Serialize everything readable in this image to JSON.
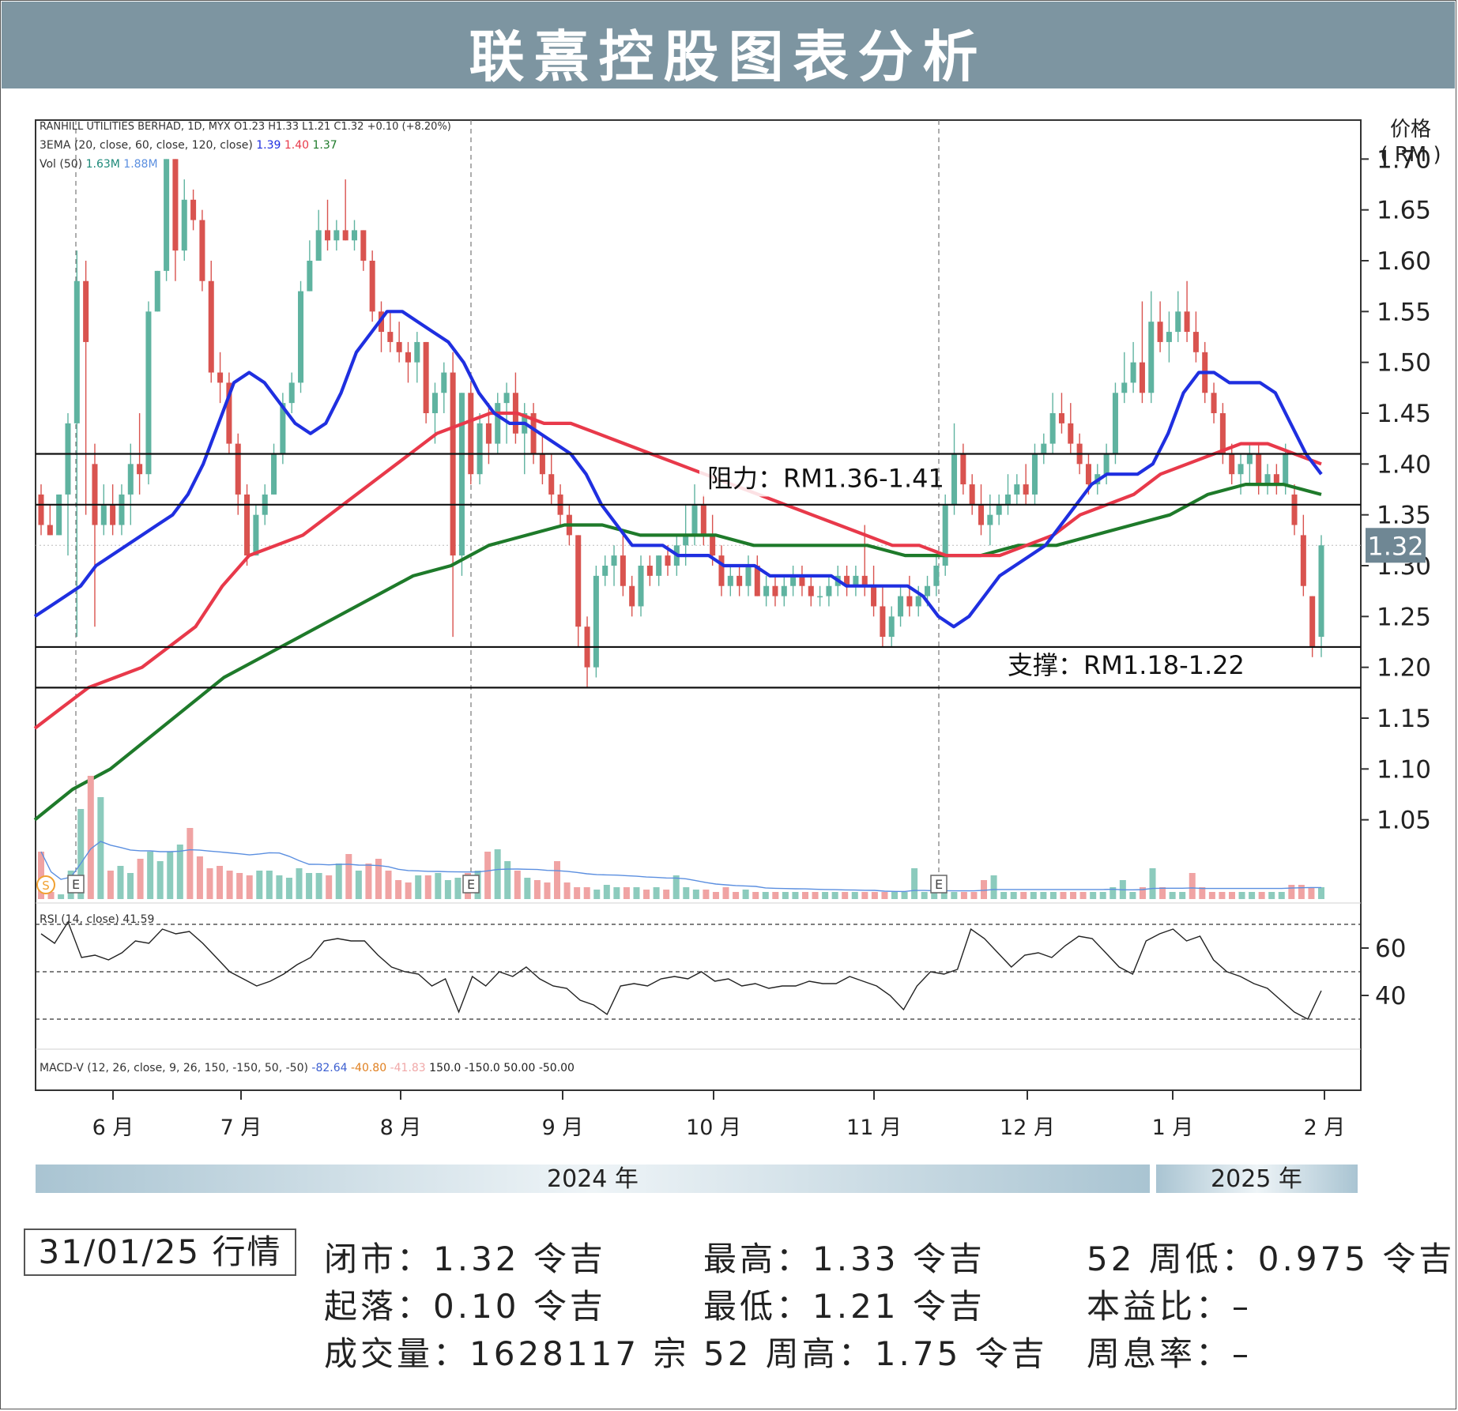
{
  "page_title": "联熹控股图表分析",
  "chart_header": {
    "line1": "RANHILL UTILITIES BERHAD, 1D, MYX  O1.23  H1.33  L1.21  C1.32  +0.10 (+8.20%)",
    "line2_prefix": "3EMA (20, close, 60, close, 120, close)",
    "ema_values": [
      "1.39",
      "1.40",
      "1.37"
    ],
    "vol_prefix": "Vol (50)",
    "vol_values": [
      "1.63M",
      "1.88M"
    ],
    "rsi_prefix": "RSI (14, close)",
    "rsi_value": "41.59",
    "macd_prefix": "MACD-V (12, 26, close, 9, 26, 150, -150, 50, -50)",
    "macd_values": [
      "-82.64",
      "-40.80",
      "-41.83",
      "150.0",
      "-150.0",
      "50.00",
      "-50.00"
    ]
  },
  "axis": {
    "y_title_1": "价格",
    "y_title_2": "( RM )",
    "y_ticks": [
      "1.70",
      "1.65",
      "1.60",
      "1.55",
      "1.50",
      "1.45",
      "1.40",
      "1.35",
      "1.30",
      "1.25",
      "1.20",
      "1.15",
      "1.10",
      "1.05"
    ],
    "rsi_ticks": [
      "60",
      "40"
    ],
    "x_months": [
      "6 月",
      "7 月",
      "8 月",
      "9 月",
      "10 月",
      "11 月",
      "12 月",
      "1 月",
      "2 月"
    ],
    "year_2024": "2024 年",
    "year_2025": "2025 年",
    "last_price": "1.32",
    "earnings_marker": "E",
    "dividend_marker": "S"
  },
  "annotations": {
    "resistance": "阻力：RM1.36-1.41",
    "support": "支撑：RM1.18-1.22"
  },
  "colors": {
    "title_bar": "#7d95a1",
    "up": "#5fb3a0",
    "down": "#d9534f",
    "ema20": "#1f2fe0",
    "ema60": "#e8394a",
    "ema120": "#1e7a2a",
    "vol_up": "#8ccbbd",
    "vol_down": "#f0a3a3",
    "vol_ma": "#5b8fe0",
    "last_price_box": "#6f8794"
  },
  "chart_data": {
    "type": "candlestick",
    "ticker": "RANHILL UTILITIES BERHAD",
    "ylim": [
      1.0,
      1.75
    ],
    "resistance_range": [
      1.36,
      1.41
    ],
    "support_range": [
      1.18,
      1.22
    ],
    "last_close": 1.32,
    "ohlc": [
      [
        1.37,
        1.38,
        1.33,
        1.34
      ],
      [
        1.34,
        1.36,
        1.33,
        1.33
      ],
      [
        1.33,
        1.37,
        1.33,
        1.37
      ],
      [
        1.37,
        1.45,
        1.31,
        1.44
      ],
      [
        1.44,
        1.61,
        1.23,
        1.58
      ],
      [
        1.58,
        1.6,
        1.35,
        1.52
      ],
      [
        1.4,
        1.42,
        1.24,
        1.34
      ],
      [
        1.34,
        1.38,
        1.33,
        1.36
      ],
      [
        1.36,
        1.38,
        1.33,
        1.34
      ],
      [
        1.34,
        1.38,
        1.33,
        1.37
      ],
      [
        1.37,
        1.42,
        1.34,
        1.4
      ],
      [
        1.4,
        1.45,
        1.37,
        1.39
      ],
      [
        1.39,
        1.56,
        1.38,
        1.55
      ],
      [
        1.55,
        1.59,
        1.55,
        1.59
      ],
      [
        1.59,
        1.7,
        1.58,
        1.7
      ],
      [
        1.7,
        1.7,
        1.58,
        1.61
      ],
      [
        1.61,
        1.68,
        1.6,
        1.66
      ],
      [
        1.66,
        1.67,
        1.63,
        1.64
      ],
      [
        1.64,
        1.65,
        1.57,
        1.58
      ],
      [
        1.58,
        1.6,
        1.48,
        1.49
      ],
      [
        1.49,
        1.51,
        1.46,
        1.48
      ],
      [
        1.48,
        1.49,
        1.41,
        1.42
      ],
      [
        1.42,
        1.43,
        1.35,
        1.37
      ],
      [
        1.37,
        1.38,
        1.3,
        1.31
      ],
      [
        1.31,
        1.36,
        1.31,
        1.35
      ],
      [
        1.35,
        1.38,
        1.34,
        1.37
      ],
      [
        1.37,
        1.42,
        1.37,
        1.41
      ],
      [
        1.41,
        1.47,
        1.4,
        1.46
      ],
      [
        1.46,
        1.49,
        1.45,
        1.48
      ],
      [
        1.48,
        1.58,
        1.47,
        1.57
      ],
      [
        1.57,
        1.62,
        1.57,
        1.6
      ],
      [
        1.6,
        1.65,
        1.6,
        1.63
      ],
      [
        1.63,
        1.66,
        1.61,
        1.62
      ],
      [
        1.62,
        1.64,
        1.61,
        1.63
      ],
      [
        1.63,
        1.68,
        1.62,
        1.62
      ],
      [
        1.62,
        1.64,
        1.61,
        1.63
      ],
      [
        1.63,
        1.63,
        1.59,
        1.6
      ],
      [
        1.6,
        1.61,
        1.54,
        1.55
      ],
      [
        1.55,
        1.56,
        1.51,
        1.53
      ],
      [
        1.53,
        1.55,
        1.51,
        1.52
      ],
      [
        1.52,
        1.54,
        1.5,
        1.51
      ],
      [
        1.51,
        1.52,
        1.48,
        1.5
      ],
      [
        1.5,
        1.53,
        1.48,
        1.52
      ],
      [
        1.52,
        1.52,
        1.44,
        1.45
      ],
      [
        1.45,
        1.48,
        1.42,
        1.47
      ],
      [
        1.47,
        1.5,
        1.45,
        1.49
      ],
      [
        1.49,
        1.51,
        1.23,
        1.31
      ],
      [
        1.31,
        1.47,
        1.29,
        1.47
      ],
      [
        1.47,
        1.48,
        1.38,
        1.39
      ],
      [
        1.39,
        1.45,
        1.38,
        1.44
      ],
      [
        1.44,
        1.46,
        1.4,
        1.42
      ],
      [
        1.42,
        1.47,
        1.41,
        1.46
      ],
      [
        1.46,
        1.48,
        1.42,
        1.47
      ],
      [
        1.47,
        1.49,
        1.42,
        1.43
      ],
      [
        1.43,
        1.46,
        1.39,
        1.45
      ],
      [
        1.45,
        1.46,
        1.4,
        1.41
      ],
      [
        1.41,
        1.43,
        1.38,
        1.39
      ],
      [
        1.39,
        1.41,
        1.36,
        1.37
      ],
      [
        1.37,
        1.38,
        1.34,
        1.35
      ],
      [
        1.35,
        1.36,
        1.32,
        1.33
      ],
      [
        1.33,
        1.33,
        1.22,
        1.24
      ],
      [
        1.24,
        1.25,
        1.18,
        1.2
      ],
      [
        1.2,
        1.3,
        1.19,
        1.29
      ],
      [
        1.29,
        1.31,
        1.28,
        1.3
      ],
      [
        1.3,
        1.32,
        1.28,
        1.31
      ],
      [
        1.31,
        1.33,
        1.27,
        1.28
      ],
      [
        1.28,
        1.29,
        1.25,
        1.26
      ],
      [
        1.26,
        1.31,
        1.25,
        1.3
      ],
      [
        1.3,
        1.31,
        1.28,
        1.29
      ],
      [
        1.29,
        1.31,
        1.28,
        1.31
      ],
      [
        1.31,
        1.32,
        1.29,
        1.3
      ],
      [
        1.3,
        1.33,
        1.29,
        1.32
      ],
      [
        1.32,
        1.36,
        1.3,
        1.33
      ],
      [
        1.33,
        1.38,
        1.32,
        1.36
      ],
      [
        1.36,
        1.37,
        1.32,
        1.33
      ],
      [
        1.33,
        1.35,
        1.3,
        1.31
      ],
      [
        1.31,
        1.32,
        1.27,
        1.28
      ],
      [
        1.28,
        1.3,
        1.27,
        1.29
      ],
      [
        1.29,
        1.3,
        1.27,
        1.28
      ],
      [
        1.28,
        1.31,
        1.27,
        1.3
      ],
      [
        1.3,
        1.31,
        1.27,
        1.27
      ],
      [
        1.27,
        1.29,
        1.26,
        1.28
      ],
      [
        1.28,
        1.29,
        1.26,
        1.27
      ],
      [
        1.27,
        1.29,
        1.26,
        1.28
      ],
      [
        1.28,
        1.3,
        1.27,
        1.29
      ],
      [
        1.29,
        1.3,
        1.27,
        1.28
      ],
      [
        1.28,
        1.29,
        1.26,
        1.27
      ],
      [
        1.27,
        1.28,
        1.26,
        1.27
      ],
      [
        1.27,
        1.29,
        1.26,
        1.28
      ],
      [
        1.28,
        1.3,
        1.27,
        1.29
      ],
      [
        1.29,
        1.3,
        1.27,
        1.28
      ],
      [
        1.28,
        1.3,
        1.27,
        1.29
      ],
      [
        1.29,
        1.34,
        1.27,
        1.28
      ],
      [
        1.28,
        1.3,
        1.25,
        1.26
      ],
      [
        1.26,
        1.28,
        1.22,
        1.23
      ],
      [
        1.23,
        1.26,
        1.22,
        1.25
      ],
      [
        1.25,
        1.28,
        1.24,
        1.27
      ],
      [
        1.27,
        1.29,
        1.25,
        1.26
      ],
      [
        1.26,
        1.28,
        1.25,
        1.27
      ],
      [
        1.27,
        1.29,
        1.26,
        1.28
      ],
      [
        1.28,
        1.31,
        1.27,
        1.3
      ],
      [
        1.3,
        1.37,
        1.29,
        1.36
      ],
      [
        1.36,
        1.44,
        1.35,
        1.41
      ],
      [
        1.41,
        1.42,
        1.37,
        1.38
      ],
      [
        1.38,
        1.39,
        1.35,
        1.36
      ],
      [
        1.36,
        1.38,
        1.33,
        1.34
      ],
      [
        1.34,
        1.37,
        1.32,
        1.35
      ],
      [
        1.35,
        1.37,
        1.34,
        1.36
      ],
      [
        1.36,
        1.39,
        1.35,
        1.37
      ],
      [
        1.37,
        1.39,
        1.36,
        1.38
      ],
      [
        1.38,
        1.4,
        1.36,
        1.37
      ],
      [
        1.37,
        1.42,
        1.36,
        1.41
      ],
      [
        1.41,
        1.43,
        1.4,
        1.42
      ],
      [
        1.42,
        1.47,
        1.41,
        1.45
      ],
      [
        1.45,
        1.47,
        1.43,
        1.44
      ],
      [
        1.44,
        1.46,
        1.41,
        1.42
      ],
      [
        1.42,
        1.43,
        1.39,
        1.4
      ],
      [
        1.4,
        1.41,
        1.37,
        1.38
      ],
      [
        1.38,
        1.4,
        1.37,
        1.39
      ],
      [
        1.39,
        1.42,
        1.38,
        1.41
      ],
      [
        1.41,
        1.48,
        1.4,
        1.47
      ],
      [
        1.47,
        1.51,
        1.46,
        1.48
      ],
      [
        1.48,
        1.52,
        1.47,
        1.5
      ],
      [
        1.5,
        1.56,
        1.46,
        1.47
      ],
      [
        1.47,
        1.57,
        1.46,
        1.54
      ],
      [
        1.54,
        1.56,
        1.51,
        1.52
      ],
      [
        1.52,
        1.55,
        1.5,
        1.53
      ],
      [
        1.53,
        1.57,
        1.52,
        1.55
      ],
      [
        1.55,
        1.58,
        1.52,
        1.53
      ],
      [
        1.53,
        1.55,
        1.5,
        1.51
      ],
      [
        1.51,
        1.52,
        1.46,
        1.47
      ],
      [
        1.47,
        1.48,
        1.44,
        1.45
      ],
      [
        1.45,
        1.46,
        1.4,
        1.41
      ],
      [
        1.41,
        1.42,
        1.38,
        1.39
      ],
      [
        1.39,
        1.41,
        1.37,
        1.4
      ],
      [
        1.4,
        1.42,
        1.38,
        1.41
      ],
      [
        1.41,
        1.42,
        1.37,
        1.38
      ],
      [
        1.38,
        1.4,
        1.37,
        1.39
      ],
      [
        1.39,
        1.4,
        1.37,
        1.38
      ],
      [
        1.38,
        1.42,
        1.37,
        1.41
      ],
      [
        1.37,
        1.38,
        1.33,
        1.34
      ],
      [
        1.33,
        1.35,
        1.27,
        1.28
      ],
      [
        1.27,
        1.27,
        1.21,
        1.22
      ],
      [
        1.23,
        1.33,
        1.21,
        1.32
      ]
    ],
    "ema20": [
      1.25,
      1.26,
      1.27,
      1.28,
      1.3,
      1.31,
      1.32,
      1.33,
      1.34,
      1.35,
      1.37,
      1.4,
      1.44,
      1.48,
      1.49,
      1.48,
      1.46,
      1.44,
      1.43,
      1.44,
      1.47,
      1.51,
      1.53,
      1.55,
      1.55,
      1.54,
      1.53,
      1.52,
      1.5,
      1.47,
      1.45,
      1.44,
      1.44,
      1.43,
      1.42,
      1.41,
      1.39,
      1.36,
      1.34,
      1.32,
      1.32,
      1.32,
      1.31,
      1.31,
      1.31,
      1.3,
      1.3,
      1.3,
      1.29,
      1.29,
      1.29,
      1.29,
      1.29,
      1.28,
      1.28,
      1.28,
      1.28,
      1.28,
      1.27,
      1.25,
      1.24,
      1.25,
      1.27,
      1.29,
      1.3,
      1.31,
      1.32,
      1.34,
      1.36,
      1.38,
      1.39,
      1.39,
      1.39,
      1.4,
      1.43,
      1.47,
      1.49,
      1.49,
      1.48,
      1.48,
      1.48,
      1.47,
      1.44,
      1.41,
      1.39
    ],
    "ema60": [
      1.14,
      1.16,
      1.18,
      1.19,
      1.2,
      1.22,
      1.24,
      1.28,
      1.31,
      1.32,
      1.33,
      1.35,
      1.37,
      1.39,
      1.41,
      1.43,
      1.44,
      1.45,
      1.45,
      1.44,
      1.44,
      1.43,
      1.42,
      1.41,
      1.4,
      1.39,
      1.38,
      1.37,
      1.36,
      1.35,
      1.34,
      1.33,
      1.32,
      1.32,
      1.31,
      1.31,
      1.31,
      1.32,
      1.33,
      1.35,
      1.36,
      1.37,
      1.39,
      1.4,
      1.41,
      1.42,
      1.42,
      1.41,
      1.4
    ],
    "ema120": [
      1.05,
      1.08,
      1.1,
      1.13,
      1.16,
      1.19,
      1.21,
      1.23,
      1.25,
      1.27,
      1.29,
      1.3,
      1.32,
      1.33,
      1.34,
      1.34,
      1.33,
      1.33,
      1.33,
      1.32,
      1.32,
      1.32,
      1.32,
      1.31,
      1.31,
      1.31,
      1.32,
      1.32,
      1.33,
      1.34,
      1.35,
      1.37,
      1.38,
      1.38,
      1.37
    ],
    "rsi": [
      66,
      62,
      71,
      56,
      57,
      55,
      58,
      63,
      62,
      68,
      66,
      67,
      62,
      56,
      50,
      47,
      44,
      46,
      49,
      53,
      56,
      63,
      64,
      63,
      63,
      57,
      52,
      50,
      49,
      44,
      47,
      33,
      48,
      44,
      50,
      48,
      52,
      47,
      44,
      43,
      38,
      36,
      32,
      44,
      45,
      44,
      47,
      48,
      47,
      50,
      46,
      47,
      44,
      45,
      43,
      44,
      44,
      46,
      45,
      45,
      48,
      46,
      44,
      40,
      34,
      44,
      50,
      49,
      51,
      68,
      64,
      58,
      52,
      57,
      58,
      56,
      61,
      65,
      64,
      58,
      52,
      49,
      63,
      66,
      68,
      63,
      65,
      55,
      50,
      48,
      45,
      43,
      38,
      33,
      30,
      42
    ],
    "volume": [
      2.0,
      0.3,
      0.2,
      1.2,
      3.8,
      5.2,
      4.3,
      1.2,
      1.4,
      1.1,
      1.7,
      2.0,
      1.6,
      2.0,
      2.3,
      3.0,
      1.8,
      1.3,
      1.4,
      1.2,
      1.1,
      1.0,
      1.2,
      1.2,
      1.0,
      0.9,
      1.3,
      1.1,
      1.1,
      1.0,
      1.5,
      1.9,
      1.2,
      1.5,
      1.7,
      1.2,
      0.8,
      0.7,
      1.0,
      1.0,
      1.1,
      0.8,
      0.9,
      1.1,
      1.2,
      2.0,
      2.1,
      1.6,
      1.2,
      0.9,
      0.8,
      0.7,
      1.6,
      0.7,
      0.5,
      0.5,
      0.4,
      0.6,
      0.5,
      0.5,
      0.5,
      0.4,
      0.5,
      0.4,
      1.0,
      0.5,
      0.4,
      0.4,
      0.3,
      0.5,
      0.3,
      0.4,
      0.3,
      0.3,
      0.3,
      0.3,
      0.3,
      0.3,
      0.3,
      0.3,
      0.3,
      0.3,
      0.3,
      0.3,
      0.3,
      0.3,
      0.3,
      0.3,
      1.3,
      0.3,
      0.3,
      0.3,
      0.3,
      0.3,
      0.3,
      0.8,
      1.0,
      0.3,
      0.3,
      0.3,
      0.3,
      0.3,
      0.3,
      0.3,
      0.3,
      0.3,
      0.3,
      0.3,
      0.5,
      0.8,
      0.3,
      0.5,
      1.3,
      0.5,
      0.3,
      0.3,
      1.1,
      0.5,
      0.3,
      0.3,
      0.3,
      0.3,
      0.3,
      0.3,
      0.3,
      0.3,
      0.6,
      0.6,
      0.5,
      0.5
    ],
    "earnings_dates_index": [
      5,
      55,
      115
    ],
    "x_month_labels": [
      "6 月",
      "7 月",
      "8 月",
      "9 月",
      "10 月",
      "11 月",
      "12 月",
      "1 月",
      "2 月"
    ]
  },
  "info": {
    "date_label": "31/01/25 行情",
    "close": "闭市：1.32 令吉",
    "change": "起落：0.10 令吉",
    "volume": "成交量：1628117 宗",
    "high": "最高：1.33 令吉",
    "low": "最低：1.21 令吉",
    "high52": "52 周高：1.75 令吉",
    "low52": "52 周低：0.975 令吉",
    "pe": "本益比：–",
    "yield": "周息率：–"
  }
}
